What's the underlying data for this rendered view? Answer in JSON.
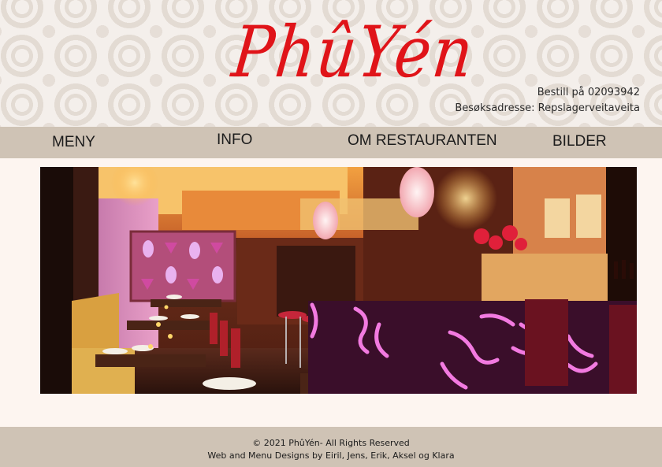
{
  "site": {
    "logo": "PhûYén"
  },
  "contact": {
    "phone_line": "Bestill på 02093942",
    "address_line": "Besøksadresse: Repslagerveitaveita"
  },
  "nav": {
    "items": [
      {
        "label": "MENY"
      },
      {
        "label": "INFO"
      },
      {
        "label": "OM RESTAURANTEN"
      },
      {
        "label": "BILDER"
      }
    ]
  },
  "footer": {
    "copyright": "© 2021 PhûYén- All Rights Reserved",
    "credits": "Web and Menu Designs by Eiril, Jens, Erik, Aksel og Klara"
  },
  "colors": {
    "brand_red": "#e01419",
    "nav_bg": "#cfc3b5",
    "page_bg": "#fdf5f0"
  }
}
